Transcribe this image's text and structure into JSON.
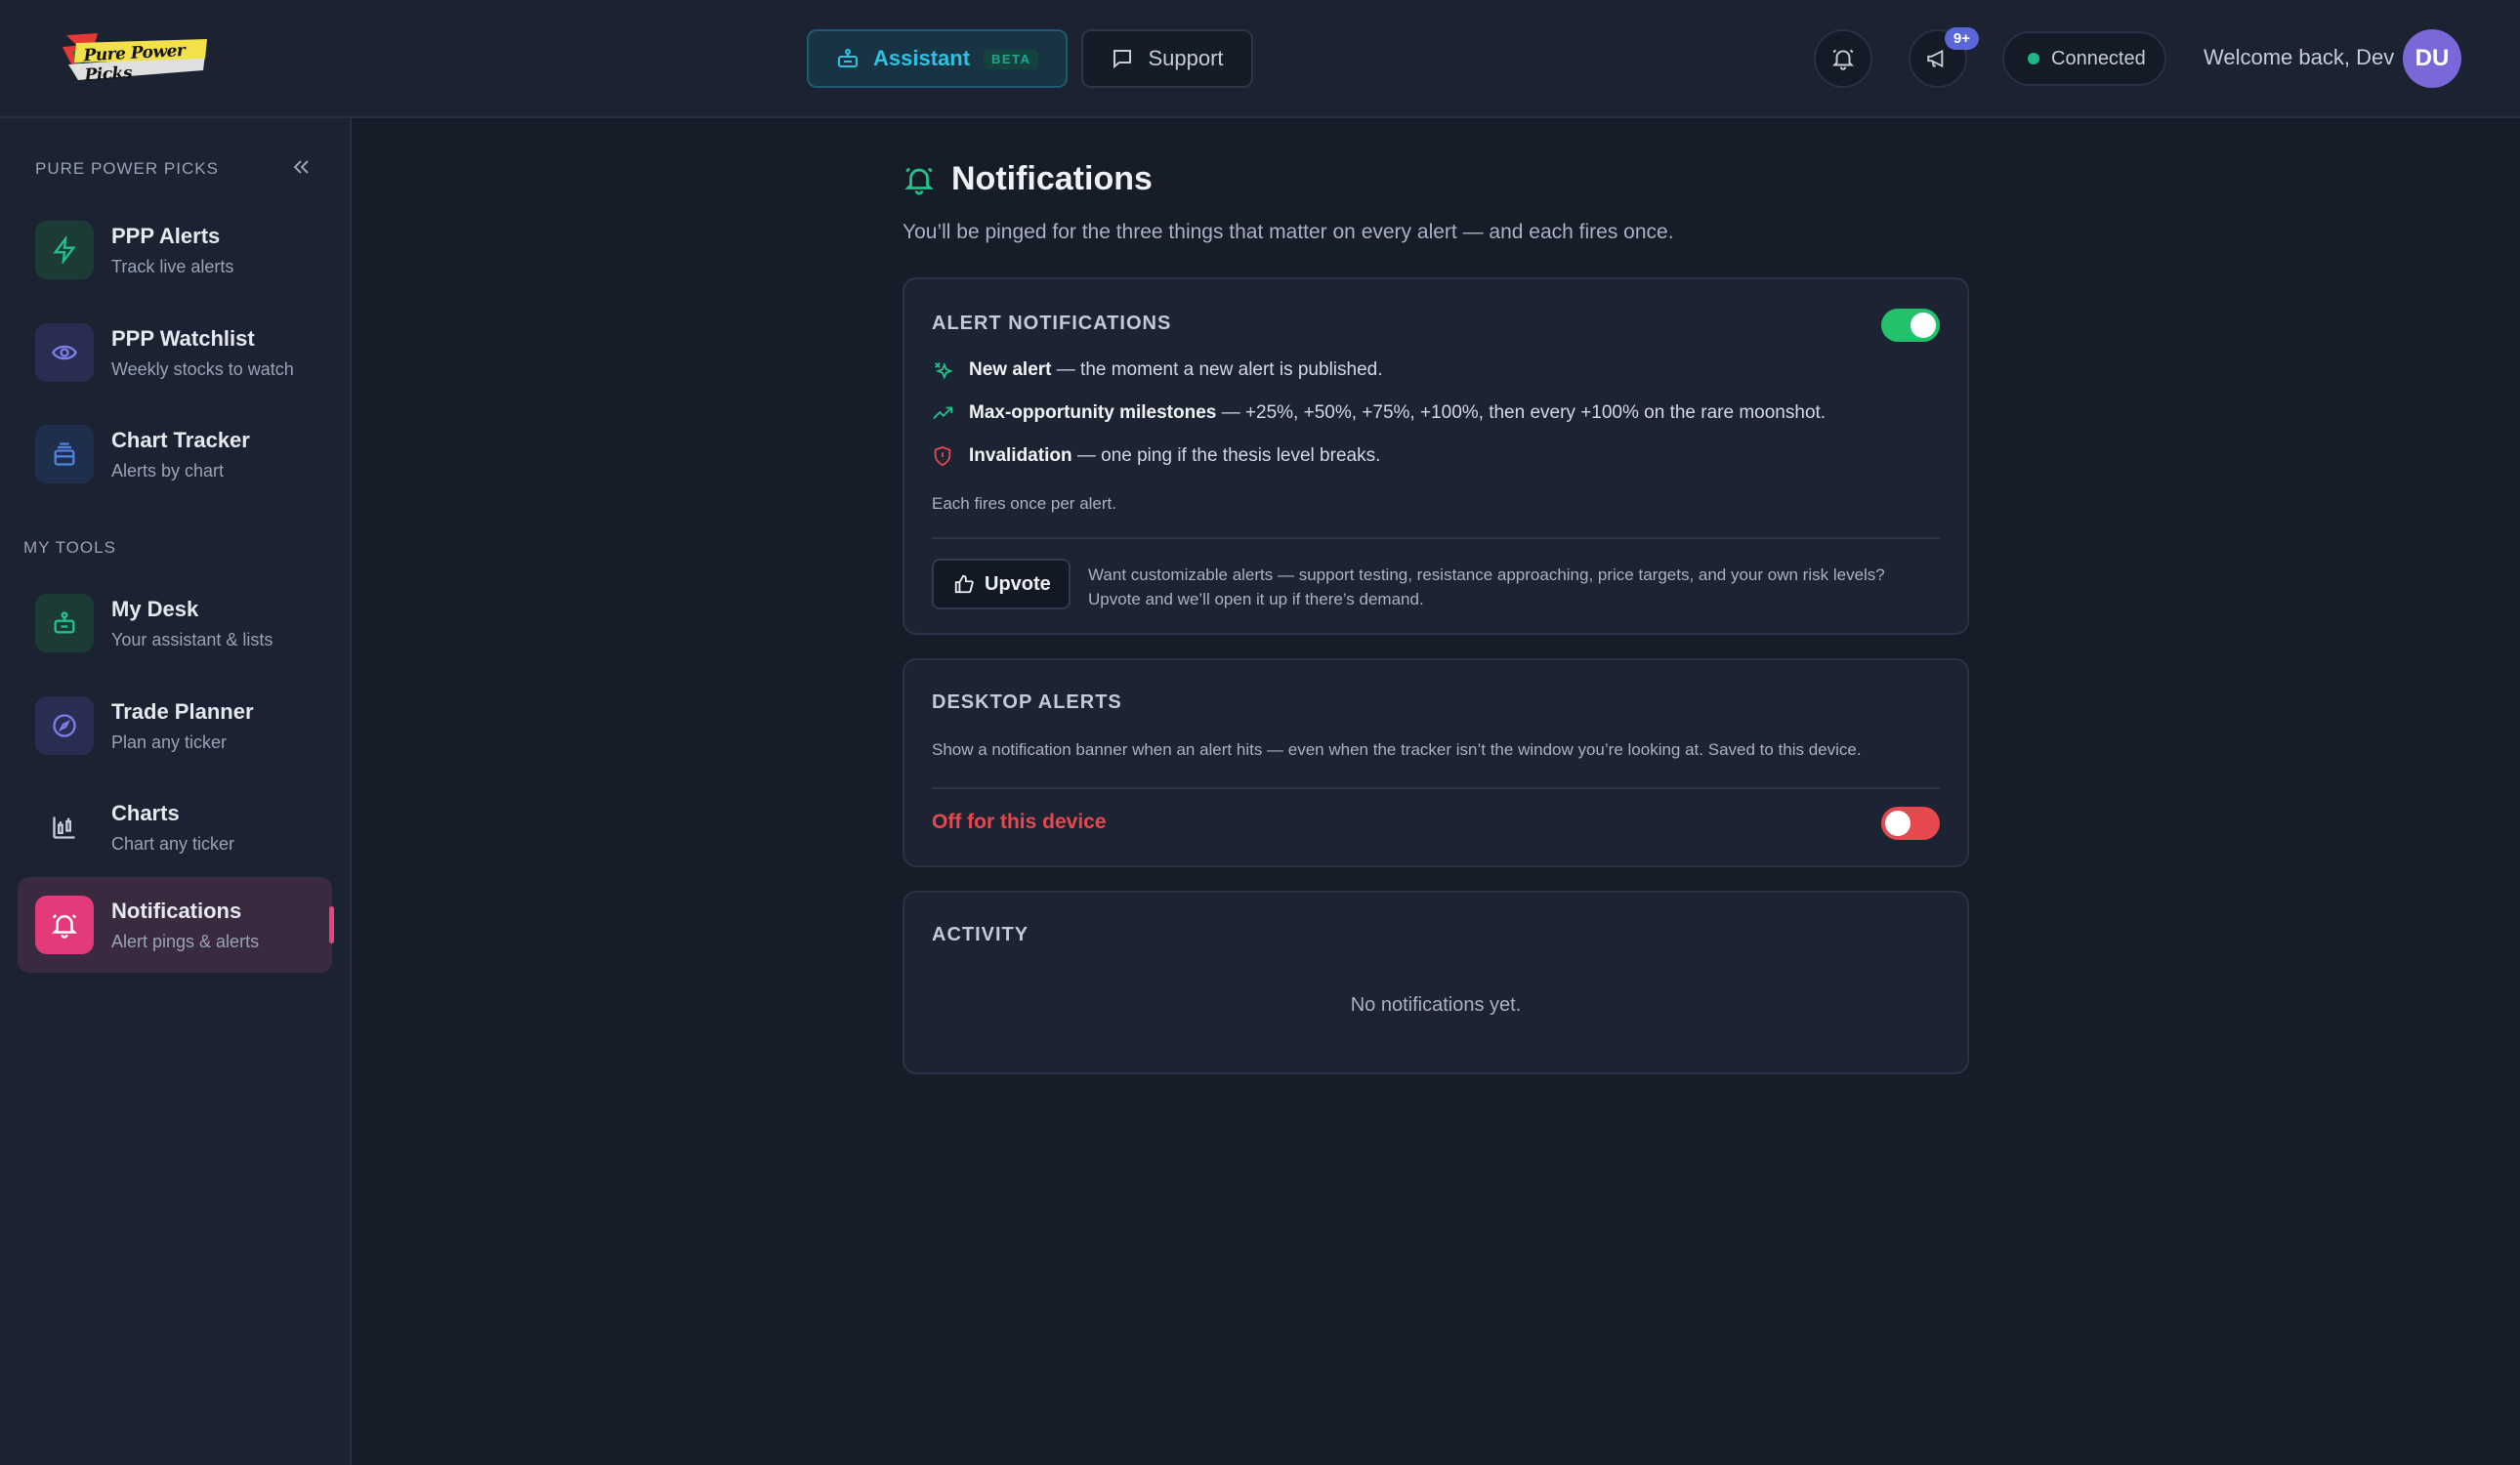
{
  "header": {
    "logo_text": "Pure Power Picks",
    "assistant_label": "Assistant",
    "assistant_badge": "BETA",
    "support_label": "Support",
    "announcements_count": "9+",
    "status": "Connected",
    "welcome": "Welcome back, Dev",
    "avatar_initials": "DU"
  },
  "sidebar": {
    "heading": "PURE POWER PICKS",
    "tools_heading": "MY TOOLS",
    "items": [
      {
        "title": "PPP Alerts",
        "sub": "Track live alerts",
        "icon": "lightning-icon"
      },
      {
        "title": "PPP Watchlist",
        "sub": "Weekly stocks to watch",
        "icon": "eye-icon"
      },
      {
        "title": "Chart Tracker",
        "sub": "Alerts by chart",
        "icon": "layers-icon"
      },
      {
        "title": "My Desk",
        "sub": "Your assistant & lists",
        "icon": "robot-icon"
      },
      {
        "title": "Trade Planner",
        "sub": "Plan any ticker",
        "icon": "compass-icon"
      },
      {
        "title": "Charts",
        "sub": "Chart any ticker",
        "icon": "candlestick-chart-icon"
      },
      {
        "title": "Notifications",
        "sub": "Alert pings & alerts",
        "icon": "bell-icon"
      }
    ]
  },
  "main": {
    "title": "Notifications",
    "description": "You’ll be pinged for the three things that matter on every alert — and each fires once.",
    "alert_card": {
      "title": "ALERT NOTIFICATIONS",
      "enabled": true,
      "features": [
        {
          "bold": "New alert",
          "text": " — the moment a new alert is published."
        },
        {
          "bold": "Max-opportunity milestones",
          "text": " — +25%, +50%, +75%, +100%, then every +100% on the rare moonshot."
        },
        {
          "bold": "Invalidation",
          "text": " — one ping if the thesis level breaks."
        }
      ],
      "note": "Each fires once per alert.",
      "upvote_label": "Upvote",
      "upvote_text_1": "Want customizable alerts — support testing, resistance approaching, price targets, and your own risk levels?",
      "upvote_text_2": "Upvote and we’ll open it up if there’s demand."
    },
    "desktop_card": {
      "title": "DESKTOP ALERTS",
      "description": "Show a notification banner when an alert hits — even when the tracker isn’t the window you’re looking at. Saved to this device.",
      "status": "Off for this device",
      "enabled": false
    },
    "activity_card": {
      "title": "ACTIVITY",
      "empty": "No notifications yet."
    }
  },
  "colors": {
    "accent_cyan": "#2cc2e0",
    "success": "#21c26b",
    "danger": "#e5484d",
    "active_pink": "#e7447c"
  }
}
